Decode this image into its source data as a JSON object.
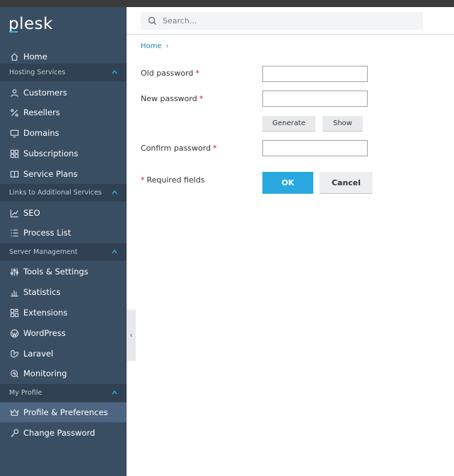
{
  "brand": {
    "logo_text": "plesk",
    "accent_color": "#2fb5e6"
  },
  "search": {
    "placeholder": "Search..."
  },
  "sidebar": {
    "home": {
      "label": "Home",
      "icon": "home-icon"
    },
    "sections": [
      {
        "title": "Hosting Services",
        "items": [
          {
            "label": "Customers",
            "icon": "user-icon"
          },
          {
            "label": "Resellers",
            "icon": "percent-icon"
          },
          {
            "label": "Domains",
            "icon": "monitor-icon"
          },
          {
            "label": "Subscriptions",
            "icon": "grid-icon"
          },
          {
            "label": "Service Plans",
            "icon": "book-icon"
          }
        ]
      },
      {
        "title": "Links to Additional Services",
        "items": [
          {
            "label": "SEO",
            "icon": "chart-up-icon"
          },
          {
            "label": "Process List",
            "icon": "list-icon"
          }
        ]
      },
      {
        "title": "Server Management",
        "items": [
          {
            "label": "Tools & Settings",
            "icon": "sliders-icon"
          },
          {
            "label": "Statistics",
            "icon": "bar-chart-icon"
          },
          {
            "label": "Extensions",
            "icon": "extensions-icon"
          },
          {
            "label": "WordPress",
            "icon": "wordpress-icon"
          },
          {
            "label": "Laravel",
            "icon": "laravel-icon"
          },
          {
            "label": "Monitoring",
            "icon": "monitoring-icon"
          }
        ]
      },
      {
        "title": "My Profile",
        "items": [
          {
            "label": "Profile & Preferences",
            "icon": "crown-icon",
            "active": true
          },
          {
            "label": "Change Password",
            "icon": "key-icon"
          }
        ]
      }
    ]
  },
  "breadcrumb": {
    "home": "Home",
    "separator": "›"
  },
  "form": {
    "old_password_label": "Old password",
    "new_password_label": "New password",
    "confirm_password_label": "Confirm password",
    "required_marker": "*",
    "generate_label": "Generate",
    "show_label": "Show",
    "required_note": "Required fields",
    "ok_label": "OK",
    "cancel_label": "Cancel"
  },
  "colors": {
    "sidebar_bg": "#3a4e63",
    "ok_button": "#29a9e0",
    "required": "#c8102e"
  }
}
